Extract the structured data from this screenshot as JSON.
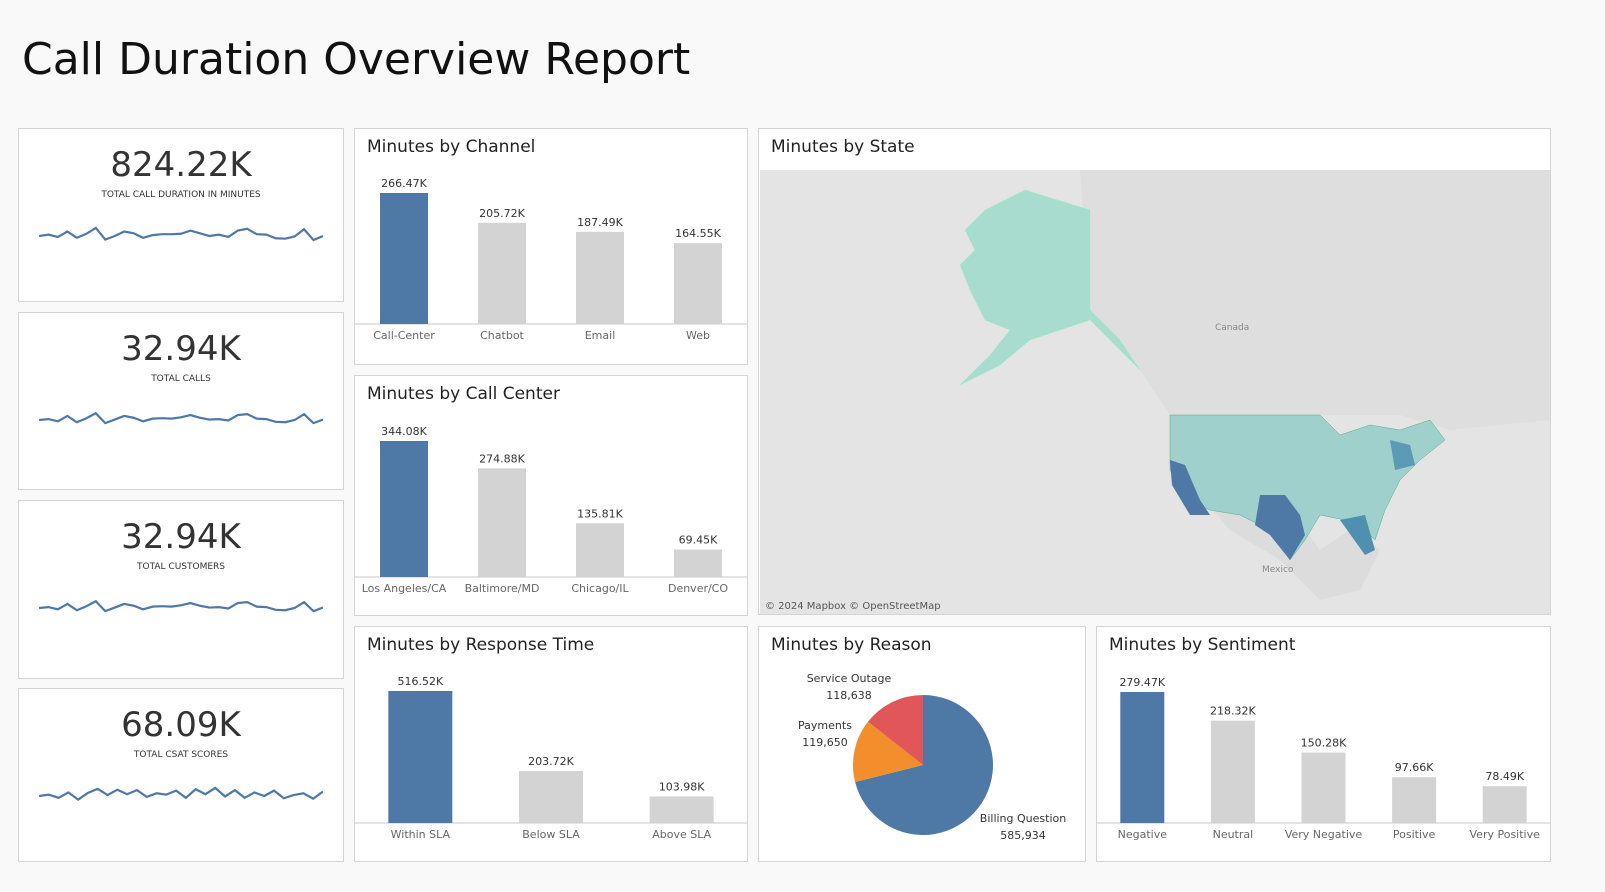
{
  "title": "Call Duration Overview Report",
  "kpis": [
    {
      "value": "824.22K",
      "label": "TOTAL CALL DURATION IN MINUTES",
      "spark": [
        5,
        5.3,
        4.8,
        6,
        4.6,
        5.5,
        6.8,
        4.2,
        5,
        6,
        5.6,
        4.6,
        5.2,
        5.4,
        5.4,
        5.5,
        6.2,
        5.6,
        5,
        5.3,
        4.8,
        6.2,
        6.6,
        5.4,
        5.3,
        4.5,
        4.4,
        4.9,
        6.5,
        4.1,
        5
      ]
    },
    {
      "value": "32.94K",
      "label": "TOTAL CALLS",
      "spark": [
        5,
        5.2,
        4.7,
        5.9,
        4.5,
        5.4,
        6.5,
        4.3,
        5.1,
        5.9,
        5.5,
        4.7,
        5.3,
        5.4,
        5.3,
        5.6,
        6.1,
        5.5,
        5.1,
        5.2,
        4.9,
        6.1,
        6.3,
        5.3,
        5.2,
        4.6,
        4.5,
        5,
        6.3,
        4.3,
        5.1
      ]
    },
    {
      "value": "32.94K",
      "label": "TOTAL CUSTOMERS",
      "spark": [
        5,
        5.2,
        4.7,
        5.9,
        4.5,
        5.4,
        6.5,
        4.3,
        5.1,
        5.9,
        5.5,
        4.7,
        5.3,
        5.4,
        5.3,
        5.6,
        6.1,
        5.5,
        5.1,
        5.2,
        4.9,
        6.1,
        6.3,
        5.3,
        5.2,
        4.6,
        4.5,
        5,
        6.3,
        4.3,
        5.1
      ]
    },
    {
      "value": "68.09K",
      "label": "TOTAL CSAT SCORES",
      "spark": [
        5,
        5.3,
        4.6,
        5.8,
        4.2,
        5.7,
        6.6,
        5.2,
        6.4,
        5.4,
        6.3,
        4.8,
        5.6,
        5.3,
        6.2,
        4.6,
        6.5,
        5.4,
        6.8,
        4.9,
        6.3,
        4.6,
        5.8,
        5,
        6.2,
        4.5,
        5.2,
        5.6,
        4.4,
        6
      ]
    }
  ],
  "channel": {
    "title": "Minutes by Channel",
    "categories": [
      "Call-Center",
      "Chatbot",
      "Email",
      "Web"
    ],
    "values": [
      266.47,
      205.72,
      187.49,
      164.55
    ],
    "labels": [
      "266.47K",
      "205.72K",
      "187.49K",
      "164.55K"
    ]
  },
  "callcenter": {
    "title": "Minutes by Call Center",
    "categories": [
      "Los Angeles/CA",
      "Baltimore/MD",
      "Chicago/IL",
      "Denver/CO"
    ],
    "values": [
      344.08,
      274.88,
      135.81,
      69.45
    ],
    "labels": [
      "344.08K",
      "274.88K",
      "135.81K",
      "69.45K"
    ]
  },
  "response": {
    "title": "Minutes by Response Time",
    "categories": [
      "Within SLA",
      "Below SLA",
      "Above SLA"
    ],
    "values": [
      516.52,
      203.72,
      103.98
    ],
    "labels": [
      "516.52K",
      "203.72K",
      "103.98K"
    ]
  },
  "sentiment": {
    "title": "Minutes by Sentiment",
    "categories": [
      "Negative",
      "Neutral",
      "Very Negative",
      "Positive",
      "Very Positive"
    ],
    "values": [
      279.47,
      218.32,
      150.28,
      97.66,
      78.49
    ],
    "labels": [
      "279.47K",
      "218.32K",
      "150.28K",
      "97.66K",
      "78.49K"
    ]
  },
  "map": {
    "title": "Minutes by State",
    "labels": {
      "canada": "Canada",
      "mexico": "Mexico"
    },
    "copyright": "© 2024 Mapbox © OpenStreetMap"
  },
  "reason": {
    "title": "Minutes by Reason",
    "slices": [
      {
        "name": "Billing Question",
        "value": 585934,
        "label": "585,934",
        "color": "#4e79a7"
      },
      {
        "name": "Payments",
        "value": 119650,
        "label": "119,650",
        "color": "#f28e2b"
      },
      {
        "name": "Service Outage",
        "value": 118638,
        "label": "118,638",
        "color": "#e15759"
      }
    ]
  },
  "colors": {
    "highlight": "#4e79a7",
    "bar": "#d3d3d3",
    "line": "#4e79a7"
  }
}
